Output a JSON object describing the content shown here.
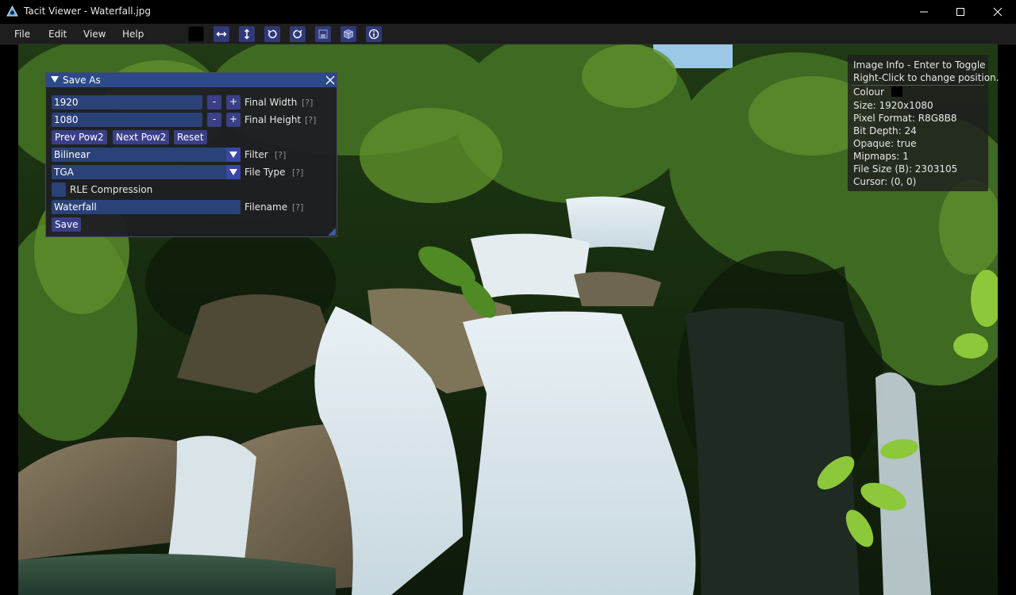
{
  "window": {
    "title": "Tacit Viewer - Waterfall.jpg"
  },
  "menu": {
    "items": [
      "File",
      "Edit",
      "View",
      "Help"
    ]
  },
  "toolbar": {
    "buttons": [
      {
        "icon": "colour-swatch-icon"
      },
      {
        "icon": "flip-horizontal-icon"
      },
      {
        "icon": "flip-vertical-icon"
      },
      {
        "icon": "rotate-ccw-icon"
      },
      {
        "icon": "rotate-cw-icon"
      },
      {
        "icon": "save-disk-icon"
      },
      {
        "icon": "cube-icon"
      },
      {
        "icon": "info-icon"
      }
    ]
  },
  "save_as": {
    "title": "Save As",
    "width_value": "1920",
    "height_value": "1080",
    "minus": "-",
    "plus": "+",
    "final_width_label": "Final Width",
    "final_height_label": "Final Height",
    "help": "[?]",
    "prev_pow2": "Prev Pow2",
    "next_pow2": "Next Pow2",
    "reset": "Reset",
    "filter_value": "Bilinear",
    "filter_label": "Filter",
    "file_type_value": "TGA",
    "file_type_label": "File Type",
    "rle_label": "RLE Compression",
    "filename_value": "Waterfall",
    "filename_label": "Filename",
    "save": "Save"
  },
  "info": {
    "line1": "Image Info - Enter to Toggle",
    "line2": "Right-Click to change position.",
    "colour": "Colour",
    "size": "Size: 1920x1080",
    "pixel_format": "Pixel Format: R8G8B8",
    "bit_depth": "Bit Depth: 24",
    "opaque": "Opaque: true",
    "mipmaps": "Mipmaps: 1",
    "file_size": "File Size (B): 2303105",
    "cursor": "Cursor: (0, 0)"
  },
  "colors": {
    "accent": "#2c4a8a",
    "button": "#3a3f88",
    "field": "#2b4278"
  }
}
